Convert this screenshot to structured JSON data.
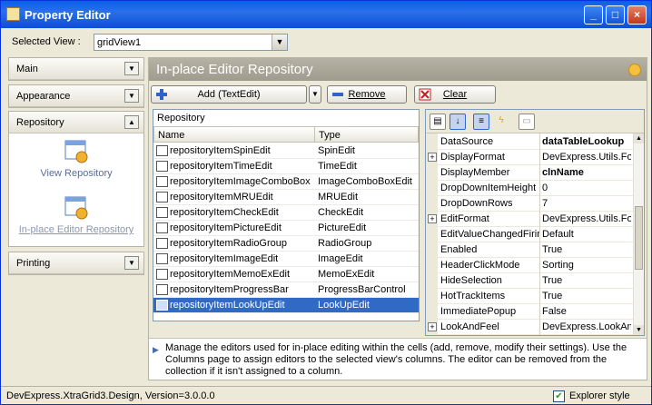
{
  "window": {
    "title": "Property Editor",
    "minimize": "_",
    "maximize": "□",
    "close": "×"
  },
  "selected_view": {
    "label": "Selected View :",
    "value": "gridView1",
    "arrow": "▼"
  },
  "sidebar": {
    "groups": [
      "Main",
      "Appearance",
      "Repository",
      "Printing"
    ],
    "chevron": "▼",
    "chevron_up": "▲",
    "repository_items": [
      "View Repository",
      "In-place Editor Repository"
    ]
  },
  "main": {
    "header": "In-place Editor Repository",
    "toolbar": {
      "add": "Add (TextEdit)",
      "add_dropdown": "▼",
      "remove": "Remove",
      "clear": "Clear"
    },
    "grid": {
      "caption": "Repository",
      "columns": [
        "Name",
        "Type"
      ],
      "rows": [
        {
          "name": "repositoryItemSpinEdit",
          "type": "SpinEdit"
        },
        {
          "name": "repositoryItemTimeEdit",
          "type": "TimeEdit"
        },
        {
          "name": "repositoryItemImageComboBox",
          "type": "ImageComboBoxEdit"
        },
        {
          "name": "repositoryItemMRUEdit",
          "type": "MRUEdit"
        },
        {
          "name": "repositoryItemCheckEdit",
          "type": "CheckEdit"
        },
        {
          "name": "repositoryItemPictureEdit",
          "type": "PictureEdit"
        },
        {
          "name": "repositoryItemRadioGroup",
          "type": "RadioGroup"
        },
        {
          "name": "repositoryItemImageEdit",
          "type": "ImageEdit"
        },
        {
          "name": "repositoryItemMemoExEdit",
          "type": "MemoExEdit"
        },
        {
          "name": "repositoryItemProgressBar",
          "type": "ProgressBarControl"
        },
        {
          "name": "repositoryItemLookUpEdit",
          "type": "LookUpEdit"
        }
      ],
      "selected_index": 10
    },
    "properties": {
      "rows": [
        {
          "name": "DataSource",
          "value": "dataTableLookup",
          "bold": true,
          "expand": ""
        },
        {
          "name": "DisplayFormat",
          "value": "DevExpress.Utils.Fo",
          "bold": false,
          "expand": "+"
        },
        {
          "name": "DisplayMember",
          "value": "clnName",
          "bold": true,
          "expand": ""
        },
        {
          "name": "DropDownItemHeight",
          "value": "0",
          "bold": false,
          "expand": ""
        },
        {
          "name": "DropDownRows",
          "value": "7",
          "bold": false,
          "expand": ""
        },
        {
          "name": "EditFormat",
          "value": "DevExpress.Utils.Fo",
          "bold": false,
          "expand": "+"
        },
        {
          "name": "EditValueChangedFirir",
          "value": "Default",
          "bold": false,
          "expand": ""
        },
        {
          "name": "Enabled",
          "value": "True",
          "bold": false,
          "expand": ""
        },
        {
          "name": "HeaderClickMode",
          "value": "Sorting",
          "bold": false,
          "expand": ""
        },
        {
          "name": "HideSelection",
          "value": "True",
          "bold": false,
          "expand": ""
        },
        {
          "name": "HotTrackItems",
          "value": "True",
          "bold": false,
          "expand": ""
        },
        {
          "name": "ImmediatePopup",
          "value": "False",
          "bold": false,
          "expand": ""
        },
        {
          "name": "LookAndFeel",
          "value": "DevExpress.LookAn",
          "bold": false,
          "expand": "+"
        }
      ]
    },
    "description": "Manage the editors used for in-place editing within the cells (add, remove, modify their settings). Use the Columns page to assign editors to the selected view's columns. The editor can be removed from the collection if it isn't assigned to a column."
  },
  "status": {
    "text": "DevExpress.XtraGrid3.Design, Version=3.0.0.0",
    "explorer_style": "Explorer style",
    "checkmark": "✔"
  }
}
